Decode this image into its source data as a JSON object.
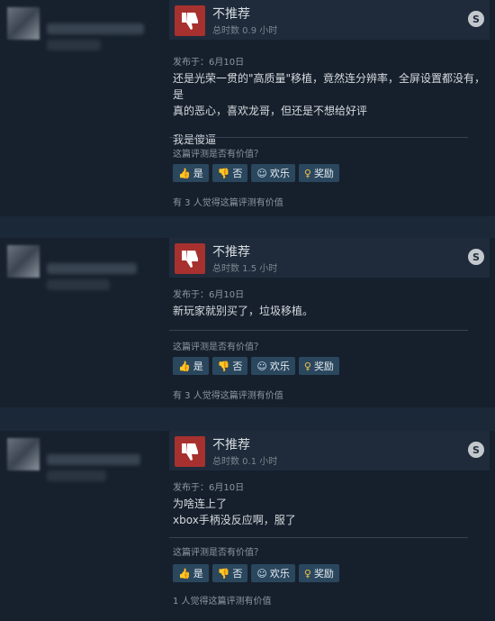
{
  "reviews": [
    {
      "title": "不推荐",
      "hours": "总时数 0.9 小时",
      "posted": "发布于：6月10日",
      "body_lines": [
        "还是光荣一贯的\"高质量\"移植，竟然连分辨率，全屏设置都没有，是",
        "真的恶心，喜欢龙哥，但还是不想给好评",
        "",
        "我是傻逼"
      ],
      "question": "这篇评测是否有价值？",
      "buttons": {
        "yes": "是",
        "no": "否",
        "funny": "欢乐",
        "award": "奖励"
      },
      "helpful": "有 3 人觉得这篇评测有价值"
    },
    {
      "title": "不推荐",
      "hours": "总时数 1.5 小时",
      "posted": "发布于：6月10日",
      "body_lines": [
        "新玩家就别买了，垃圾移植。"
      ],
      "question": "这篇评测是否有价值？",
      "buttons": {
        "yes": "是",
        "no": "否",
        "funny": "欢乐",
        "award": "奖励"
      },
      "helpful": "有 3 人觉得这篇评测有价值"
    },
    {
      "title": "不推荐",
      "hours": "总时数 0.1 小时",
      "posted": "发布于：6月10日",
      "body_lines": [
        "为啥连上了",
        "xbox手柄没反应啊，服了"
      ],
      "question": "这篇评测是否有价值？",
      "buttons": {
        "yes": "是",
        "no": "否",
        "funny": "欢乐",
        "award": "奖励"
      },
      "helpful": "1 人觉得这篇评测有价值"
    }
  ],
  "icons": {
    "thumb_down": "thumbs-down-icon",
    "steam": "steam-logo-icon",
    "yes": "thumbs-up-icon",
    "no": "thumbs-down-icon",
    "funny": "smiley-icon",
    "award": "award-icon"
  },
  "colors": {
    "thumb_bg": "#a7312f",
    "button_bg": "#2a475e",
    "page_bg": "#1b2838"
  }
}
